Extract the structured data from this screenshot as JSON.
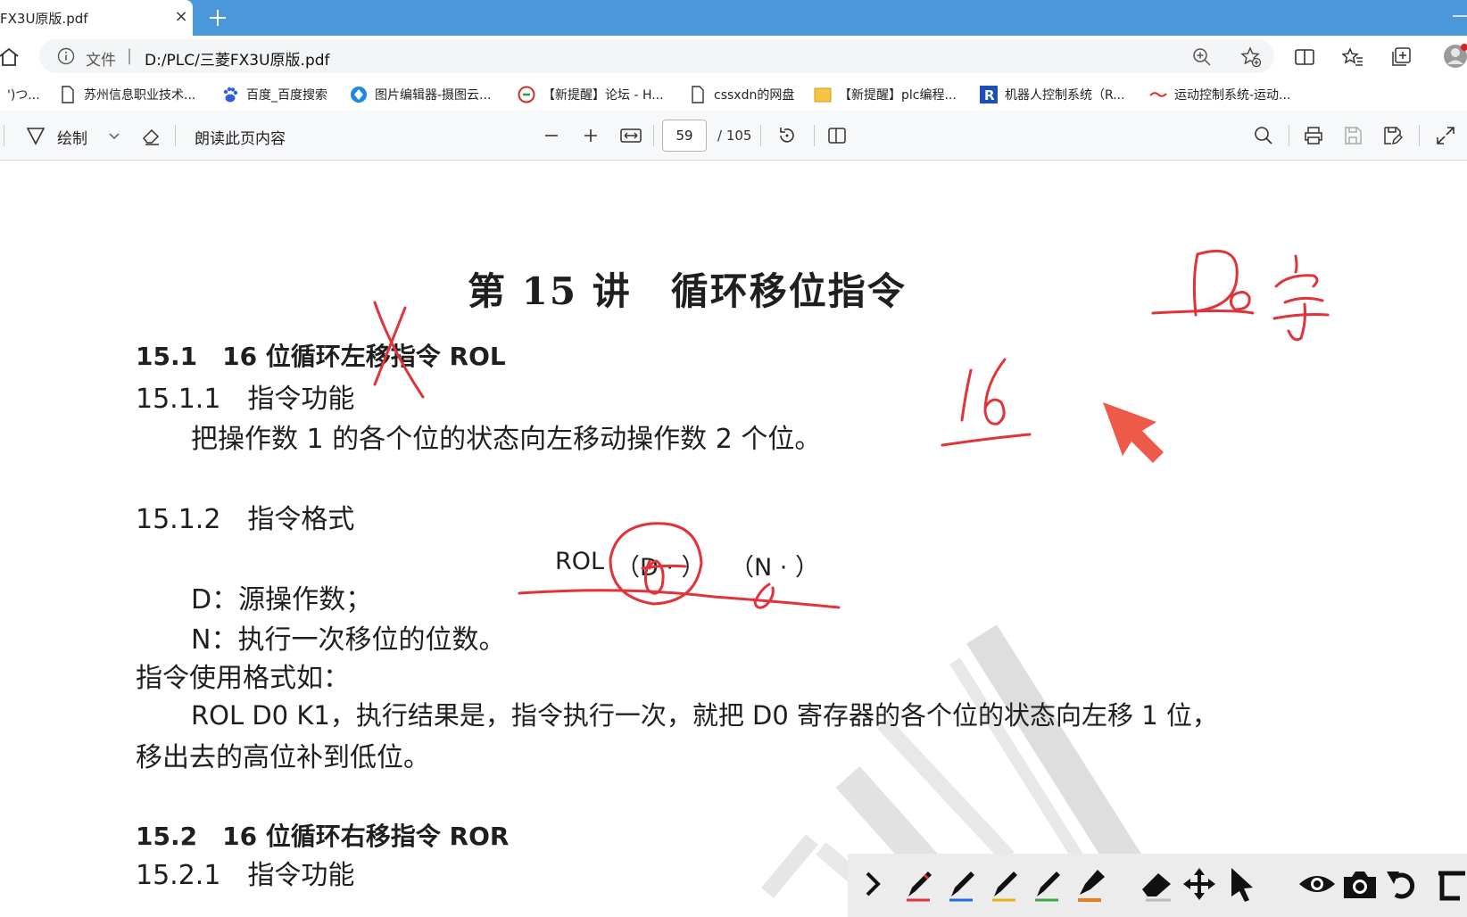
{
  "tab": {
    "title": "FX3U原版.pdf",
    "close": "×"
  },
  "address": {
    "file_label": "文件",
    "separator": "|",
    "url": "D:/PLC/三菱FX3U原版.pdf"
  },
  "bookmarks": [
    {
      "label": "')つ..."
    },
    {
      "label": "苏州信息职业技术..."
    },
    {
      "label": "百度_百度搜索"
    },
    {
      "label": "图片编辑器-摄图云..."
    },
    {
      "label": "【新提醒】论坛 - H..."
    },
    {
      "label": "cssxdn的网盘"
    },
    {
      "label": "【新提醒】plc编程..."
    },
    {
      "label": "机器人控制系统（R..."
    },
    {
      "label": "运动控制系统-运动..."
    }
  ],
  "pdf_toolbar": {
    "draw_label": "绘制",
    "read_aloud": "朗读此页内容",
    "page_current": "59",
    "page_total": "/ 105"
  },
  "document": {
    "title": "第 15 讲　循环移位指令",
    "s1": "15.1　16 位循环左移指令 ROL",
    "s1_1": "15.1.1　指令功能",
    "s1_1_body": "把操作数 1 的各个位的状态向左移动操作数 2 个位。",
    "s1_2": "15.1.2　指令格式",
    "format_op": "ROL",
    "format_d": "（D · ）",
    "format_n": "（N · ）",
    "d_desc": "D：源操作数；",
    "n_desc": "N：执行一次移位的位数。",
    "usage_intro": "指令使用格式如：",
    "usage_line1": "ROL D0 K1，执行结果是，指令执行一次，就把 D0 寄存器的各个位的状态向左移 1 位，",
    "usage_line2": "移出去的高位补到低位。",
    "s2": "15.2　16 位循环右移指令 ROR",
    "s2_1": "15.2.1　指令功能"
  },
  "colors": {
    "tabstrip": "#4a97d9",
    "annotation_red": "#e0333a",
    "pointer_red": "#ee5a4a"
  }
}
